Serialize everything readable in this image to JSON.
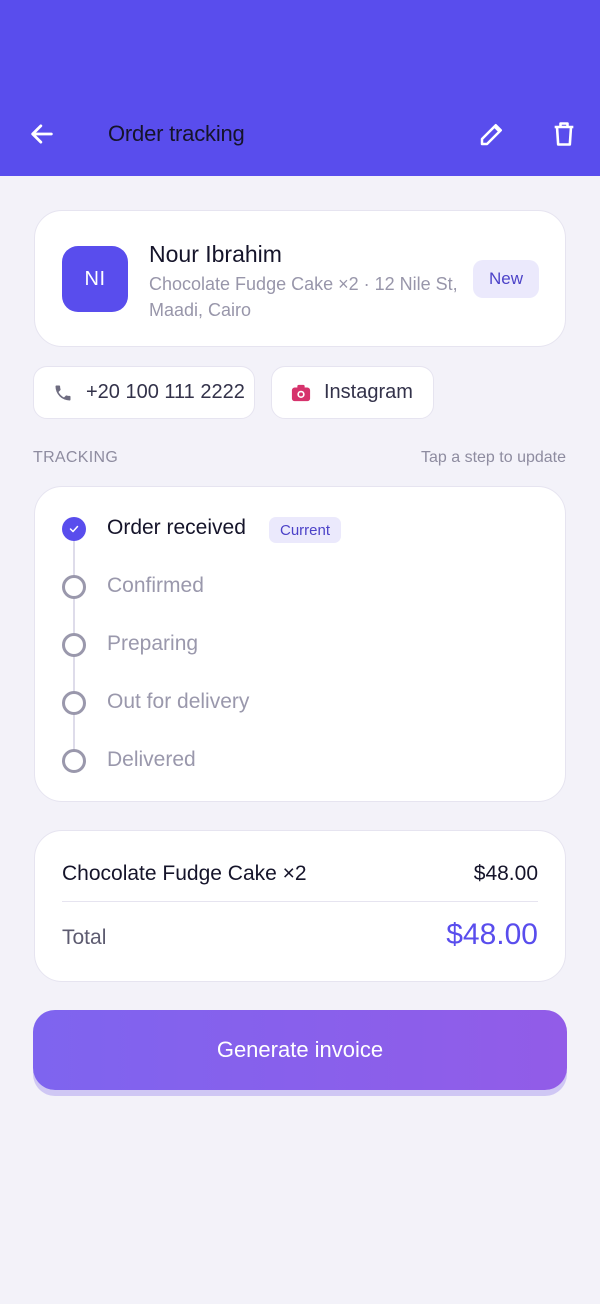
{
  "header": {
    "title": "Order tracking",
    "bg_color": "#594ded",
    "back_icon": "arrow-left-icon",
    "edit_icon": "pencil-icon",
    "delete_icon": "trash-icon"
  },
  "customer": {
    "initials": "NI",
    "name": "Nour Ibrahim",
    "subtitle": "Chocolate Fudge Cake ×2 · 12 Nile St, Maadi, Cairo",
    "status": "New"
  },
  "contacts": {
    "phone": "+20 100 111 2222",
    "phone_icon": "phone-icon",
    "channel": "Instagram",
    "channel_icon": "instagram-camera-icon",
    "channel_color": "#d6336c"
  },
  "tracking": {
    "section_label": "TRACKING",
    "hint": "Tap a step to update",
    "current_badge": "Current",
    "steps": [
      {
        "label": "Order received",
        "done": true
      },
      {
        "label": "Confirmed",
        "done": false
      },
      {
        "label": "Preparing",
        "done": false
      },
      {
        "label": "Out for delivery",
        "done": false
      },
      {
        "label": "Delivered",
        "done": false
      }
    ]
  },
  "summary": {
    "items": [
      {
        "name": "Chocolate Fudge Cake ×2",
        "price": "$48.00"
      }
    ],
    "total_label": "Total",
    "total_value": "$48.00",
    "accent_color": "#594ded"
  },
  "actions": {
    "generate_invoice": "Generate invoice"
  }
}
